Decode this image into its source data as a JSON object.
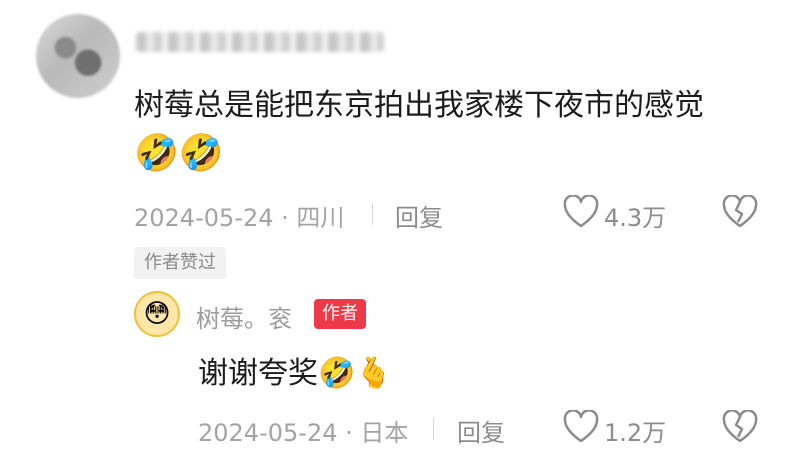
{
  "comment": {
    "text": "树莓总是能把东京拍出我家楼下夜市的感觉",
    "emojis": "🤣🤣",
    "date": "2024-05-24",
    "location": "· 四川",
    "reply_label": "回复",
    "likes": "4.3万",
    "author_liked_label": "作者赞过"
  },
  "reply": {
    "author_name": "树莓。衮",
    "author_badge": "作者",
    "text": "谢谢夸奖",
    "emojis": "🤣🫰",
    "date": "2024-05-24",
    "location": "· 日本",
    "reply_label": "回复",
    "likes": "1.2万"
  },
  "colors": {
    "author_badge": "#ee3a48",
    "meta_text": "#a3a3a3"
  },
  "icons": {
    "like": "heart-outline-icon",
    "dislike": "broken-heart-icon"
  }
}
